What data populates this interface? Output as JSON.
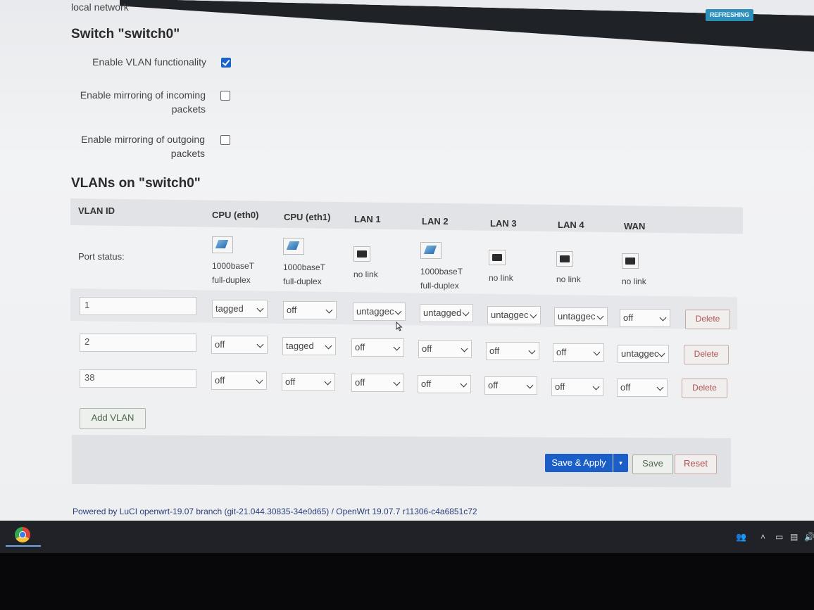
{
  "header": {
    "breadcrumb_tail": "local network",
    "status_badge": "REFRESHING"
  },
  "switch_section": {
    "title": "Switch \"switch0\"",
    "options": [
      {
        "label_line1": "Enable VLAN functionality",
        "label_line2": "",
        "checked": true
      },
      {
        "label_line1": "Enable mirroring of incoming",
        "label_line2": "packets",
        "checked": false
      },
      {
        "label_line1": "Enable mirroring of outgoing",
        "label_line2": "packets",
        "checked": false
      }
    ]
  },
  "vlans": {
    "title": "VLANs on \"switch0\"",
    "columns": [
      "VLAN ID",
      "CPU (eth0)",
      "CPU (eth1)",
      "LAN 1",
      "LAN 2",
      "LAN 3",
      "LAN 4",
      "WAN"
    ],
    "port_status_label": "Port status:",
    "port_status": [
      {
        "icon": "port-link-icon",
        "line1": "1000baseT",
        "line2": "full-duplex"
      },
      {
        "icon": "port-link-icon",
        "line1": "1000baseT",
        "line2": "full-duplex"
      },
      {
        "icon": "port-nolink-icon",
        "line1": "no link",
        "line2": ""
      },
      {
        "icon": "port-link-icon",
        "line1": "1000baseT",
        "line2": "full-duplex"
      },
      {
        "icon": "port-nolink-icon",
        "line1": "no link",
        "line2": ""
      },
      {
        "icon": "port-nolink-icon",
        "line1": "no link",
        "line2": ""
      },
      {
        "icon": "port-nolink-icon",
        "line1": "no link",
        "line2": ""
      }
    ],
    "rows": [
      {
        "vlan_id": "1",
        "ports": [
          "tagged",
          "off",
          "untaggec",
          "untagged",
          "untaggec",
          "untaggec",
          "off"
        ]
      },
      {
        "vlan_id": "2",
        "ports": [
          "off",
          "tagged",
          "off",
          "off",
          "off",
          "off",
          "untaggec"
        ]
      },
      {
        "vlan_id": "38",
        "ports": [
          "off",
          "off",
          "off",
          "off",
          "off",
          "off",
          "off"
        ]
      }
    ],
    "delete_label": "Delete",
    "add_label": "Add VLAN"
  },
  "actions": {
    "save_apply": "Save & Apply",
    "save_apply_caret": "▾",
    "save": "Save",
    "reset": "Reset"
  },
  "footer": {
    "powered_by": "Powered by LuCI openwrt-19.07 branch (git-21.044.30835-34e0d65) / OpenWrt 19.07.7 r11306-c4a6851c72"
  },
  "colors": {
    "primary_button": "#1b5ec8",
    "delete_text": "#b05050",
    "badge": "#2b8fb8"
  }
}
